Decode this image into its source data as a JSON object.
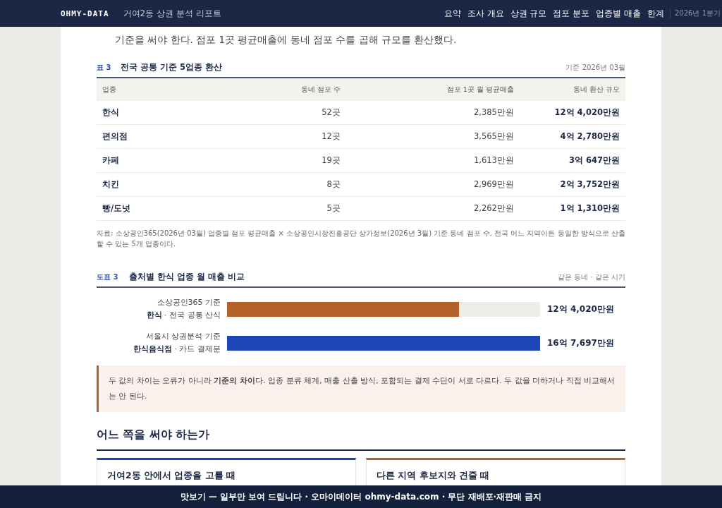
{
  "header": {
    "logo": "OHMY-DATA",
    "title": "거여2동 상권 분석 리포트",
    "nav": [
      {
        "label": "요약",
        "selected": false
      },
      {
        "label": "조사 개요",
        "selected": false
      },
      {
        "label": "상권 규모",
        "selected": false
      },
      {
        "label": "점포 분포",
        "selected": false
      },
      {
        "label": "업종별 매출",
        "selected": false
      },
      {
        "label": "한계",
        "selected": false
      }
    ],
    "period": "2026년 1분기"
  },
  "intro": "기준을 써야 한다. 점포 1곳 평균매출에 동네 점포 수를 곱해 규모를 환산했다.",
  "table": {
    "number": "표 3",
    "title": "전국 공통 기준 5업종 환산",
    "note": "기준 2026년 03월",
    "columns": [
      "업종",
      "동네 점포 수",
      "점포 1곳 월 평균매출",
      "동네 환산 규모"
    ],
    "rows": [
      [
        "한식",
        "52곳",
        "2,385만원",
        "12억 4,020만원"
      ],
      [
        "편의점",
        "12곳",
        "3,565만원",
        "4억 2,780만원"
      ],
      [
        "카페",
        "19곳",
        "1,613만원",
        "3억 647만원"
      ],
      [
        "치킨",
        "8곳",
        "2,969만원",
        "2억 3,752만원"
      ],
      [
        "빵/도넛",
        "5곳",
        "2,262만원",
        "1억 1,310만원"
      ]
    ],
    "source": "자료: 소상공인365(2026년 03월) 업종별 점포 평균매출 × 소상공인시장진흥공단 상가정보(2026년 3월) 기준 동네 점포 수. 전국 어느 지역이든 동일한 방식으로 산출할 수 있는 5개 업종이다."
  },
  "figure": {
    "number": "도표 3",
    "title": "출처별 한식 업종 월 매출 비교",
    "note": "같은 동네 · 같은 시기",
    "bars": [
      {
        "source": "소상공인365 기준",
        "industry": "한식",
        "method": "· 전국 공통 산식",
        "level": 0.74,
        "value": "12억 4,020만원",
        "color": "#b5612c"
      },
      {
        "source": "서울시 상권분석 기준",
        "industry": "한식음식점",
        "method": "· 카드 결제분",
        "level": 1.0,
        "value": "16억 7,697만원",
        "color": "#1c45b5"
      }
    ]
  },
  "callout": "두 값의 차이는 오류가 아니라 **기준의 차이**다. 업종 분류 체계, 매출 산출 방식, 포함되는 결제 수단이 서로 다르다. 두 값을 더하거나 직접 비교해서는 안 된다.",
  "section": {
    "heading": "어느 쪽을 써야 하는가",
    "cards": [
      {
        "title": "거여2동 안에서 업종을 고를 때",
        "color": "#1c45b5"
      },
      {
        "title": "다른 지역 후보지와 견줄 때",
        "color": "#b5612c"
      }
    ]
  },
  "footer": "맛보기 — 일부만 보여 드립니다 · 오마이데이터 ohmy-data.com · 무단 재배포·재판매 금지"
}
